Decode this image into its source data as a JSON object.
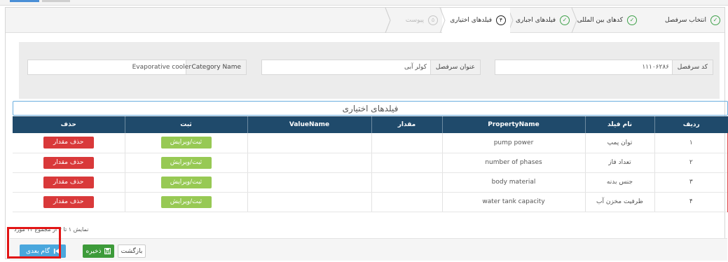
{
  "wizard": {
    "steps": [
      {
        "label": "انتخاب سرفصل",
        "icon": "check-icon",
        "state": "done"
      },
      {
        "label": "کدهای بین المللی",
        "icon": "check-icon",
        "state": "done"
      },
      {
        "label": "فیلدهای اجباری",
        "icon": "check-icon",
        "state": "done"
      },
      {
        "label": "فیلدهای اختیاری",
        "number": "۴",
        "state": "active"
      },
      {
        "label": "پیوست",
        "number": "۵",
        "state": "disabled"
      }
    ]
  },
  "info": {
    "code_label": "کد سرفصل",
    "code_value": "۱۱۱۰۶۲۸۶",
    "title_label": "عنوان سرفصل",
    "title_value": "کولر آبی",
    "category_label": "Category Name",
    "category_value": "Evaporative cooler"
  },
  "table": {
    "caption": "فیلدهای اختیاری",
    "headers": {
      "row": "ردیف",
      "field_name": "نام فیلد",
      "property": "PropertyName",
      "amount": "مقدار",
      "value_name": "ValueName",
      "submit": "ثبت",
      "delete": "حذف"
    },
    "rows": [
      {
        "index": "۱",
        "field": "توان پمپ",
        "property": "pump power"
      },
      {
        "index": "۲",
        "field": "تعداد فاز",
        "property": "number of phases"
      },
      {
        "index": "۳",
        "field": "جنس بدنه",
        "property": "body material"
      },
      {
        "index": "۴",
        "field": "ظرفیت مخزن آب",
        "property": "water tank capacity"
      }
    ],
    "submit_label": "ثبت/ویرایش",
    "delete_label": "حذف مقدار"
  },
  "footer": {
    "paging": "نمایش ۱ تا ۴ از مجموع ۱۴ مورد",
    "back_label": "بازگشت",
    "save_label": "ذخیره",
    "next_label": "گام بعدی"
  },
  "colors": {
    "header_bg": "#1f4a6b",
    "delete": "#d9393a",
    "submit": "#97c954",
    "save": "#3d9b3a",
    "next": "#4aa7dd",
    "highlight": "#e21515"
  }
}
